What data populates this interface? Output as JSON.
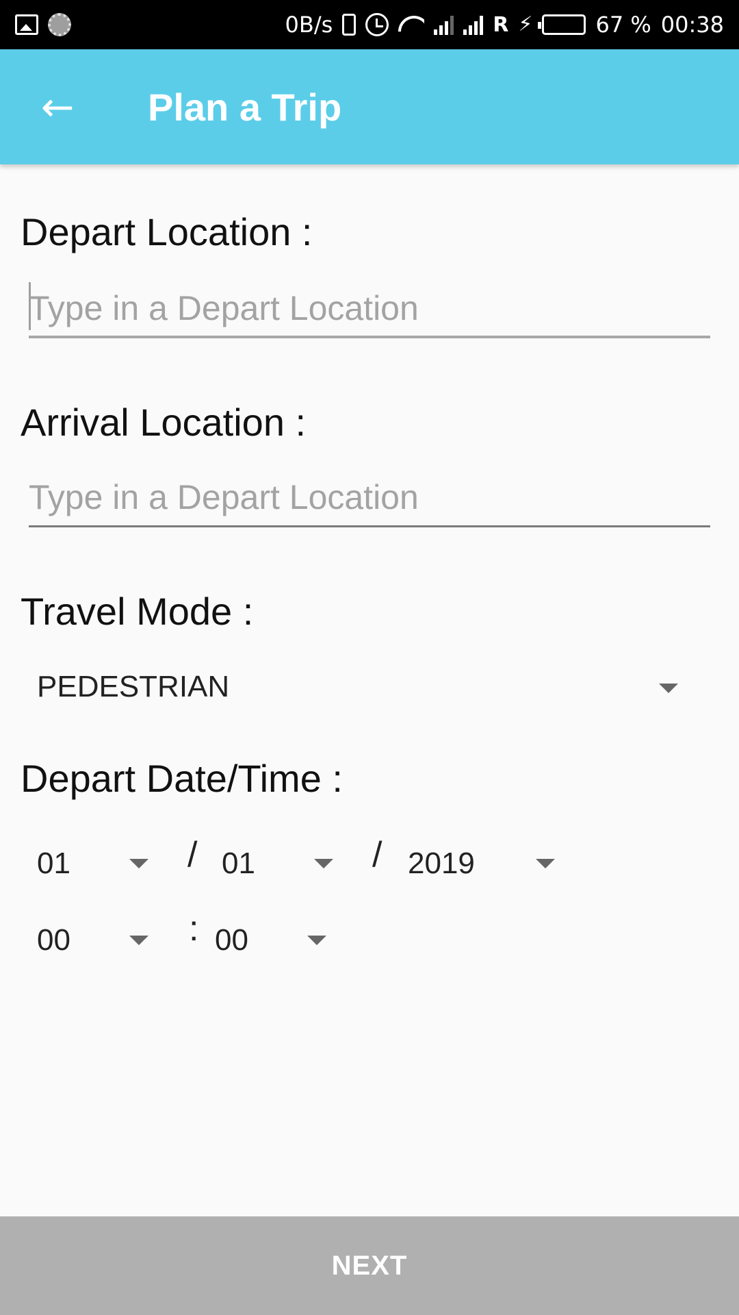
{
  "status_bar": {
    "net_speed": "0B/s",
    "roaming_indicator": "R",
    "battery_percent": "67 %",
    "time": "00:38",
    "battery_level": 0.67,
    "icons": [
      "gallery-icon",
      "loader-icon",
      "vibrate-icon",
      "alarm-icon",
      "wifi-icon",
      "signal-icon",
      "signal-icon",
      "charging-icon",
      "battery-icon"
    ]
  },
  "app_bar": {
    "back_icon": "arrow-left-icon",
    "title": "Plan a Trip",
    "background": "#5bcde9"
  },
  "form": {
    "depart_location": {
      "label": "Depart Location :",
      "value": "",
      "placeholder": "Type in a Depart Location"
    },
    "arrival_location": {
      "label": "Arrival Location :",
      "value": "",
      "placeholder": "Type in a Depart Location"
    },
    "travel_mode": {
      "label": "Travel Mode :",
      "selected": "PEDESTRIAN"
    },
    "depart_datetime": {
      "label": "Depart Date/Time :",
      "day": "01",
      "month": "01",
      "year": "2019",
      "hour": "00",
      "minute": "00",
      "date_separator": "/",
      "time_separator": ":"
    }
  },
  "next_button": {
    "label": "NEXT",
    "background": "#b0b0b0"
  }
}
